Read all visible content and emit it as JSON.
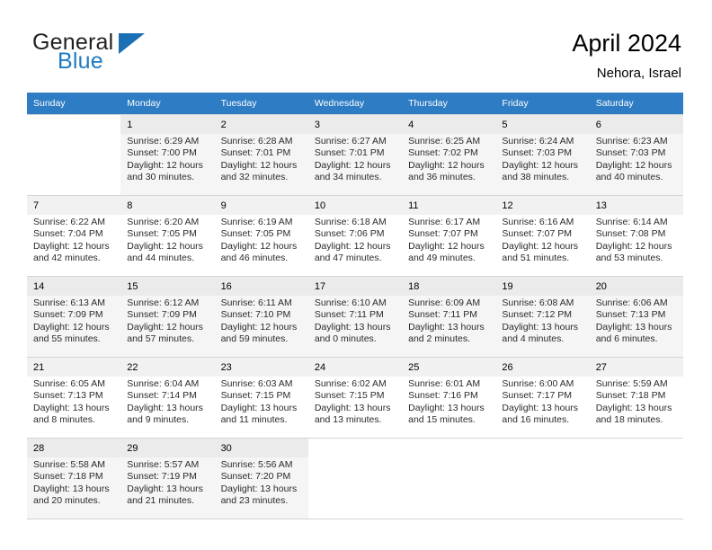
{
  "brand": {
    "line1": "General",
    "line2": "Blue",
    "flag_icon": "triangle-flag-icon",
    "accent_color": "#1e7ac4"
  },
  "header": {
    "title": "April 2024",
    "subtitle": "Nehora, Israel"
  },
  "calendar": {
    "header_bg": "#2e7cc3",
    "weekdays": [
      "Sunday",
      "Monday",
      "Tuesday",
      "Wednesday",
      "Thursday",
      "Friday",
      "Saturday"
    ],
    "weeks": [
      [
        {
          "day": "",
          "sunrise": "",
          "sunset": "",
          "daylight1": "",
          "daylight2": ""
        },
        {
          "day": "1",
          "sunrise": "Sunrise: 6:29 AM",
          "sunset": "Sunset: 7:00 PM",
          "daylight1": "Daylight: 12 hours",
          "daylight2": "and 30 minutes."
        },
        {
          "day": "2",
          "sunrise": "Sunrise: 6:28 AM",
          "sunset": "Sunset: 7:01 PM",
          "daylight1": "Daylight: 12 hours",
          "daylight2": "and 32 minutes."
        },
        {
          "day": "3",
          "sunrise": "Sunrise: 6:27 AM",
          "sunset": "Sunset: 7:01 PM",
          "daylight1": "Daylight: 12 hours",
          "daylight2": "and 34 minutes."
        },
        {
          "day": "4",
          "sunrise": "Sunrise: 6:25 AM",
          "sunset": "Sunset: 7:02 PM",
          "daylight1": "Daylight: 12 hours",
          "daylight2": "and 36 minutes."
        },
        {
          "day": "5",
          "sunrise": "Sunrise: 6:24 AM",
          "sunset": "Sunset: 7:03 PM",
          "daylight1": "Daylight: 12 hours",
          "daylight2": "and 38 minutes."
        },
        {
          "day": "6",
          "sunrise": "Sunrise: 6:23 AM",
          "sunset": "Sunset: 7:03 PM",
          "daylight1": "Daylight: 12 hours",
          "daylight2": "and 40 minutes."
        }
      ],
      [
        {
          "day": "7",
          "sunrise": "Sunrise: 6:22 AM",
          "sunset": "Sunset: 7:04 PM",
          "daylight1": "Daylight: 12 hours",
          "daylight2": "and 42 minutes."
        },
        {
          "day": "8",
          "sunrise": "Sunrise: 6:20 AM",
          "sunset": "Sunset: 7:05 PM",
          "daylight1": "Daylight: 12 hours",
          "daylight2": "and 44 minutes."
        },
        {
          "day": "9",
          "sunrise": "Sunrise: 6:19 AM",
          "sunset": "Sunset: 7:05 PM",
          "daylight1": "Daylight: 12 hours",
          "daylight2": "and 46 minutes."
        },
        {
          "day": "10",
          "sunrise": "Sunrise: 6:18 AM",
          "sunset": "Sunset: 7:06 PM",
          "daylight1": "Daylight: 12 hours",
          "daylight2": "and 47 minutes."
        },
        {
          "day": "11",
          "sunrise": "Sunrise: 6:17 AM",
          "sunset": "Sunset: 7:07 PM",
          "daylight1": "Daylight: 12 hours",
          "daylight2": "and 49 minutes."
        },
        {
          "day": "12",
          "sunrise": "Sunrise: 6:16 AM",
          "sunset": "Sunset: 7:07 PM",
          "daylight1": "Daylight: 12 hours",
          "daylight2": "and 51 minutes."
        },
        {
          "day": "13",
          "sunrise": "Sunrise: 6:14 AM",
          "sunset": "Sunset: 7:08 PM",
          "daylight1": "Daylight: 12 hours",
          "daylight2": "and 53 minutes."
        }
      ],
      [
        {
          "day": "14",
          "sunrise": "Sunrise: 6:13 AM",
          "sunset": "Sunset: 7:09 PM",
          "daylight1": "Daylight: 12 hours",
          "daylight2": "and 55 minutes."
        },
        {
          "day": "15",
          "sunrise": "Sunrise: 6:12 AM",
          "sunset": "Sunset: 7:09 PM",
          "daylight1": "Daylight: 12 hours",
          "daylight2": "and 57 minutes."
        },
        {
          "day": "16",
          "sunrise": "Sunrise: 6:11 AM",
          "sunset": "Sunset: 7:10 PM",
          "daylight1": "Daylight: 12 hours",
          "daylight2": "and 59 minutes."
        },
        {
          "day": "17",
          "sunrise": "Sunrise: 6:10 AM",
          "sunset": "Sunset: 7:11 PM",
          "daylight1": "Daylight: 13 hours",
          "daylight2": "and 0 minutes."
        },
        {
          "day": "18",
          "sunrise": "Sunrise: 6:09 AM",
          "sunset": "Sunset: 7:11 PM",
          "daylight1": "Daylight: 13 hours",
          "daylight2": "and 2 minutes."
        },
        {
          "day": "19",
          "sunrise": "Sunrise: 6:08 AM",
          "sunset": "Sunset: 7:12 PM",
          "daylight1": "Daylight: 13 hours",
          "daylight2": "and 4 minutes."
        },
        {
          "day": "20",
          "sunrise": "Sunrise: 6:06 AM",
          "sunset": "Sunset: 7:13 PM",
          "daylight1": "Daylight: 13 hours",
          "daylight2": "and 6 minutes."
        }
      ],
      [
        {
          "day": "21",
          "sunrise": "Sunrise: 6:05 AM",
          "sunset": "Sunset: 7:13 PM",
          "daylight1": "Daylight: 13 hours",
          "daylight2": "and 8 minutes."
        },
        {
          "day": "22",
          "sunrise": "Sunrise: 6:04 AM",
          "sunset": "Sunset: 7:14 PM",
          "daylight1": "Daylight: 13 hours",
          "daylight2": "and 9 minutes."
        },
        {
          "day": "23",
          "sunrise": "Sunrise: 6:03 AM",
          "sunset": "Sunset: 7:15 PM",
          "daylight1": "Daylight: 13 hours",
          "daylight2": "and 11 minutes."
        },
        {
          "day": "24",
          "sunrise": "Sunrise: 6:02 AM",
          "sunset": "Sunset: 7:15 PM",
          "daylight1": "Daylight: 13 hours",
          "daylight2": "and 13 minutes."
        },
        {
          "day": "25",
          "sunrise": "Sunrise: 6:01 AM",
          "sunset": "Sunset: 7:16 PM",
          "daylight1": "Daylight: 13 hours",
          "daylight2": "and 15 minutes."
        },
        {
          "day": "26",
          "sunrise": "Sunrise: 6:00 AM",
          "sunset": "Sunset: 7:17 PM",
          "daylight1": "Daylight: 13 hours",
          "daylight2": "and 16 minutes."
        },
        {
          "day": "27",
          "sunrise": "Sunrise: 5:59 AM",
          "sunset": "Sunset: 7:18 PM",
          "daylight1": "Daylight: 13 hours",
          "daylight2": "and 18 minutes."
        }
      ],
      [
        {
          "day": "28",
          "sunrise": "Sunrise: 5:58 AM",
          "sunset": "Sunset: 7:18 PM",
          "daylight1": "Daylight: 13 hours",
          "daylight2": "and 20 minutes."
        },
        {
          "day": "29",
          "sunrise": "Sunrise: 5:57 AM",
          "sunset": "Sunset: 7:19 PM",
          "daylight1": "Daylight: 13 hours",
          "daylight2": "and 21 minutes."
        },
        {
          "day": "30",
          "sunrise": "Sunrise: 5:56 AM",
          "sunset": "Sunset: 7:20 PM",
          "daylight1": "Daylight: 13 hours",
          "daylight2": "and 23 minutes."
        },
        {
          "day": "",
          "sunrise": "",
          "sunset": "",
          "daylight1": "",
          "daylight2": ""
        },
        {
          "day": "",
          "sunrise": "",
          "sunset": "",
          "daylight1": "",
          "daylight2": ""
        },
        {
          "day": "",
          "sunrise": "",
          "sunset": "",
          "daylight1": "",
          "daylight2": ""
        },
        {
          "day": "",
          "sunrise": "",
          "sunset": "",
          "daylight1": "",
          "daylight2": ""
        }
      ]
    ]
  }
}
